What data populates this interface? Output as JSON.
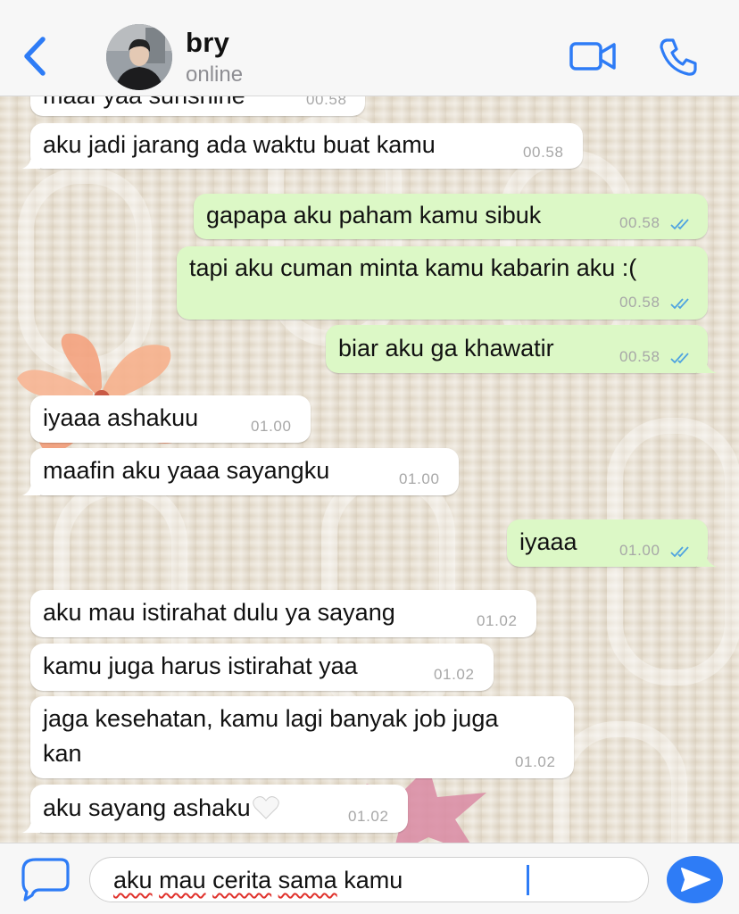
{
  "header": {
    "contact_name": "bry",
    "status": "online",
    "icons": [
      "back-chevron-icon",
      "video-camera-icon",
      "phone-icon"
    ],
    "accent_color": "#2e7cf6"
  },
  "messages": [
    {
      "direction": "incoming",
      "text": "maaf yaa sunshine",
      "time": "00.58"
    },
    {
      "direction": "incoming",
      "text": "aku jadi jarang ada waktu buat kamu",
      "time": "00.58"
    },
    {
      "direction": "outgoing",
      "text": "gapapa aku paham kamu sibuk",
      "time": "00.58",
      "read": true
    },
    {
      "direction": "outgoing",
      "text": "tapi aku cuman minta kamu kabarin aku :(",
      "time": "00.58",
      "read": true
    },
    {
      "direction": "outgoing",
      "text": "biar aku ga khawatir",
      "time": "00.58",
      "read": true
    },
    {
      "direction": "incoming",
      "text": "iyaaa ashakuu",
      "time": "01.00"
    },
    {
      "direction": "incoming",
      "text": "maafin aku yaaa sayangku",
      "time": "01.00"
    },
    {
      "direction": "outgoing",
      "text": "iyaaa",
      "time": "01.00",
      "read": true
    },
    {
      "direction": "incoming",
      "text": "aku mau istirahat dulu ya sayang",
      "time": "01.02"
    },
    {
      "direction": "incoming",
      "text": "kamu juga harus istirahat yaa",
      "time": "01.02"
    },
    {
      "direction": "incoming",
      "text_line1": "jaga kesehatan, kamu lagi banyak job juga",
      "text_line2": "kan",
      "time": "01.02"
    },
    {
      "direction": "incoming",
      "text": "aku sayang ashaku",
      "emoji": "white-heart-icon",
      "time": "01.02"
    }
  ],
  "composer": {
    "value": "aku mau cerita sama kamu",
    "words": [
      "aku",
      "mau",
      "cerita",
      "sama",
      "kamu"
    ],
    "icons": [
      "attach-sticker-icon",
      "send-arrow-icon"
    ]
  },
  "colors": {
    "outgoing_bubble": "#dcf8c6",
    "incoming_bubble": "#ffffff",
    "read_ticks": "#4fa3e0"
  }
}
